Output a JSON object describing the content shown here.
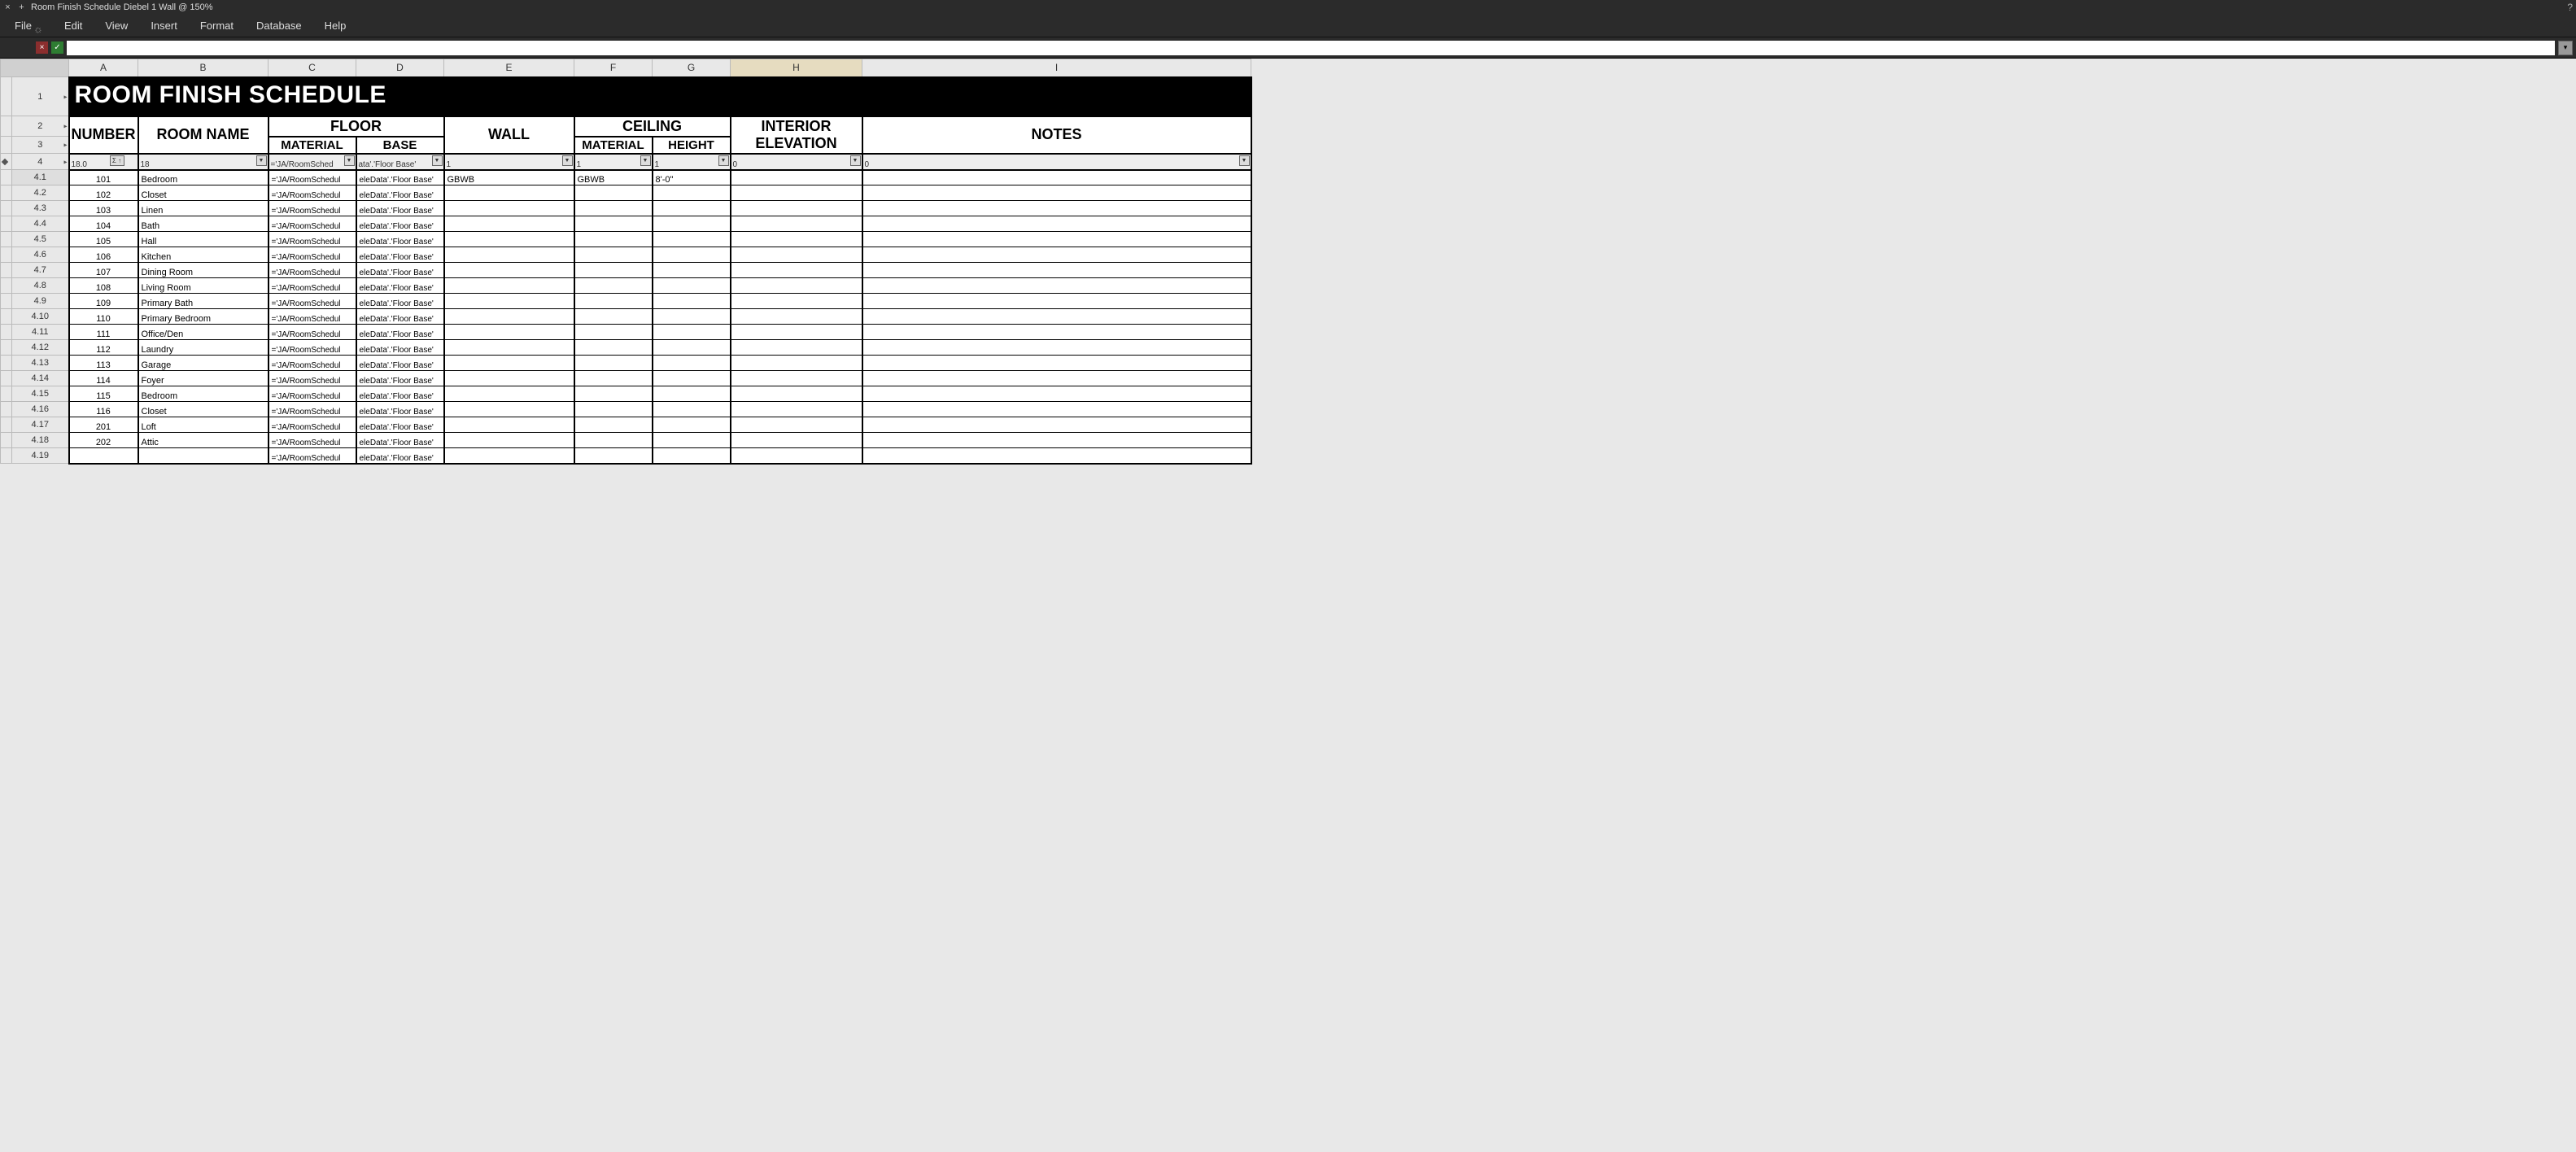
{
  "window": {
    "close": "×",
    "add": "+",
    "title": "Room Finish Schedule Diebel 1 Wall @ 150%",
    "help": "?"
  },
  "menu": {
    "file": "File",
    "edit": "Edit",
    "view": "View",
    "insert": "Insert",
    "format": "Format",
    "database": "Database",
    "help": "Help"
  },
  "formula_bar": {
    "cancel": "×",
    "accept": "✓",
    "value": "",
    "dropdown": "▾"
  },
  "columns": [
    "A",
    "B",
    "C",
    "D",
    "E",
    "F",
    "G",
    "H",
    "I"
  ],
  "row_headers": {
    "r1": "1",
    "r2": "2",
    "r3": "3",
    "r4": "4",
    "s": [
      "4.1",
      "4.2",
      "4.3",
      "4.4",
      "4.5",
      "4.6",
      "4.7",
      "4.8",
      "4.9",
      "4.10",
      "4.11",
      "4.12",
      "4.13",
      "4.14",
      "4.15",
      "4.16",
      "4.17",
      "4.18",
      "4.19"
    ]
  },
  "banner": "ROOM FINISH SCHEDULE",
  "headers": {
    "number": "NUMBER",
    "room_name": "ROOM NAME",
    "floor": "FLOOR",
    "material": "MATERIAL",
    "base": "BASE",
    "wall": "WALL",
    "ceiling": "CEILING",
    "height": "HEIGHT",
    "interior_elev": "INTERIOR ELEVATION",
    "notes": "NOTES"
  },
  "filter_row": {
    "A": "18.0",
    "A_sigma": "Σ ↑",
    "B": "18",
    "C": "='JA/RoomSched",
    "D": "ata'.'Floor Base'",
    "E": "1",
    "F": "1",
    "G": "1",
    "H": "0",
    "I": "0"
  },
  "rows": [
    {
      "num": "101",
      "name": "Bedroom",
      "wall": "GBWB",
      "cmat": "GBWB",
      "cht": "8'-0\""
    },
    {
      "num": "102",
      "name": "Closet"
    },
    {
      "num": "103",
      "name": "Linen"
    },
    {
      "num": "104",
      "name": "Bath"
    },
    {
      "num": "105",
      "name": "Hall"
    },
    {
      "num": "106",
      "name": "Kitchen"
    },
    {
      "num": "107",
      "name": "Dining Room"
    },
    {
      "num": "108",
      "name": "Living Room"
    },
    {
      "num": "109",
      "name": "Primary Bath"
    },
    {
      "num": "110",
      "name": "Primary Bedroom"
    },
    {
      "num": "111",
      "name": "Office/Den"
    },
    {
      "num": "112",
      "name": "Laundry"
    },
    {
      "num": "113",
      "name": "Garage"
    },
    {
      "num": "114",
      "name": "Foyer"
    },
    {
      "num": "115",
      "name": "Bedroom"
    },
    {
      "num": "116",
      "name": "Closet"
    },
    {
      "num": "201",
      "name": "Loft"
    },
    {
      "num": "202",
      "name": "Attic"
    },
    {
      "num": "",
      "name": ""
    }
  ],
  "formula_c": "='JA/RoomSchedul",
  "formula_d": "eleData'.'Floor Base'"
}
